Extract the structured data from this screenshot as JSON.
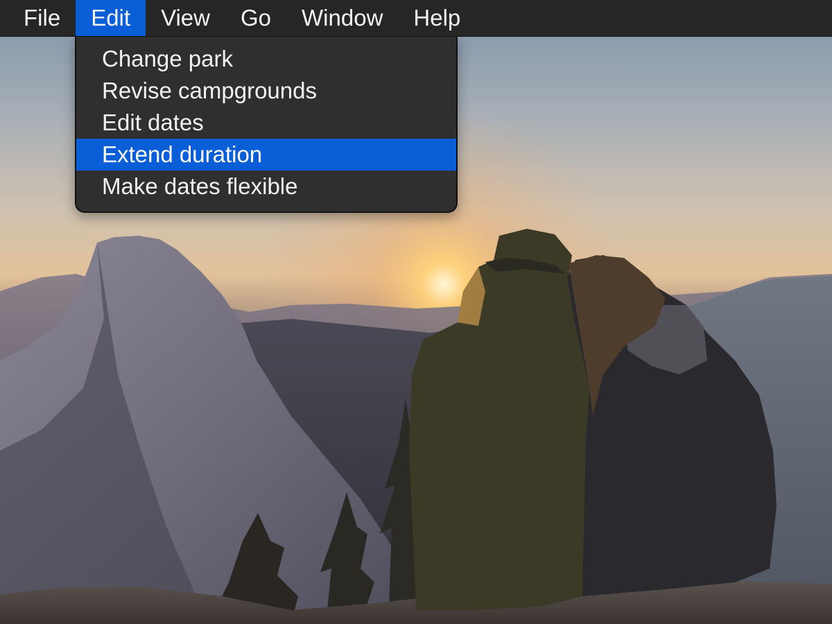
{
  "menubar": {
    "items": [
      {
        "label": "File"
      },
      {
        "label": "Edit"
      },
      {
        "label": "View"
      },
      {
        "label": "Go"
      },
      {
        "label": "Window"
      },
      {
        "label": "Help"
      }
    ],
    "active": "Edit"
  },
  "dropdown": {
    "items": [
      {
        "label": "Change park"
      },
      {
        "label": "Revise campgrounds"
      },
      {
        "label": "Edit dates"
      },
      {
        "label": "Extend duration"
      },
      {
        "label": "Make dates flexible"
      }
    ],
    "highlighted": "Extend duration"
  },
  "colors": {
    "menubar_bg": "#262626",
    "menu_bg": "#2f2f2f",
    "accent": "#0a5fd8",
    "text": "#f2f2f2"
  }
}
